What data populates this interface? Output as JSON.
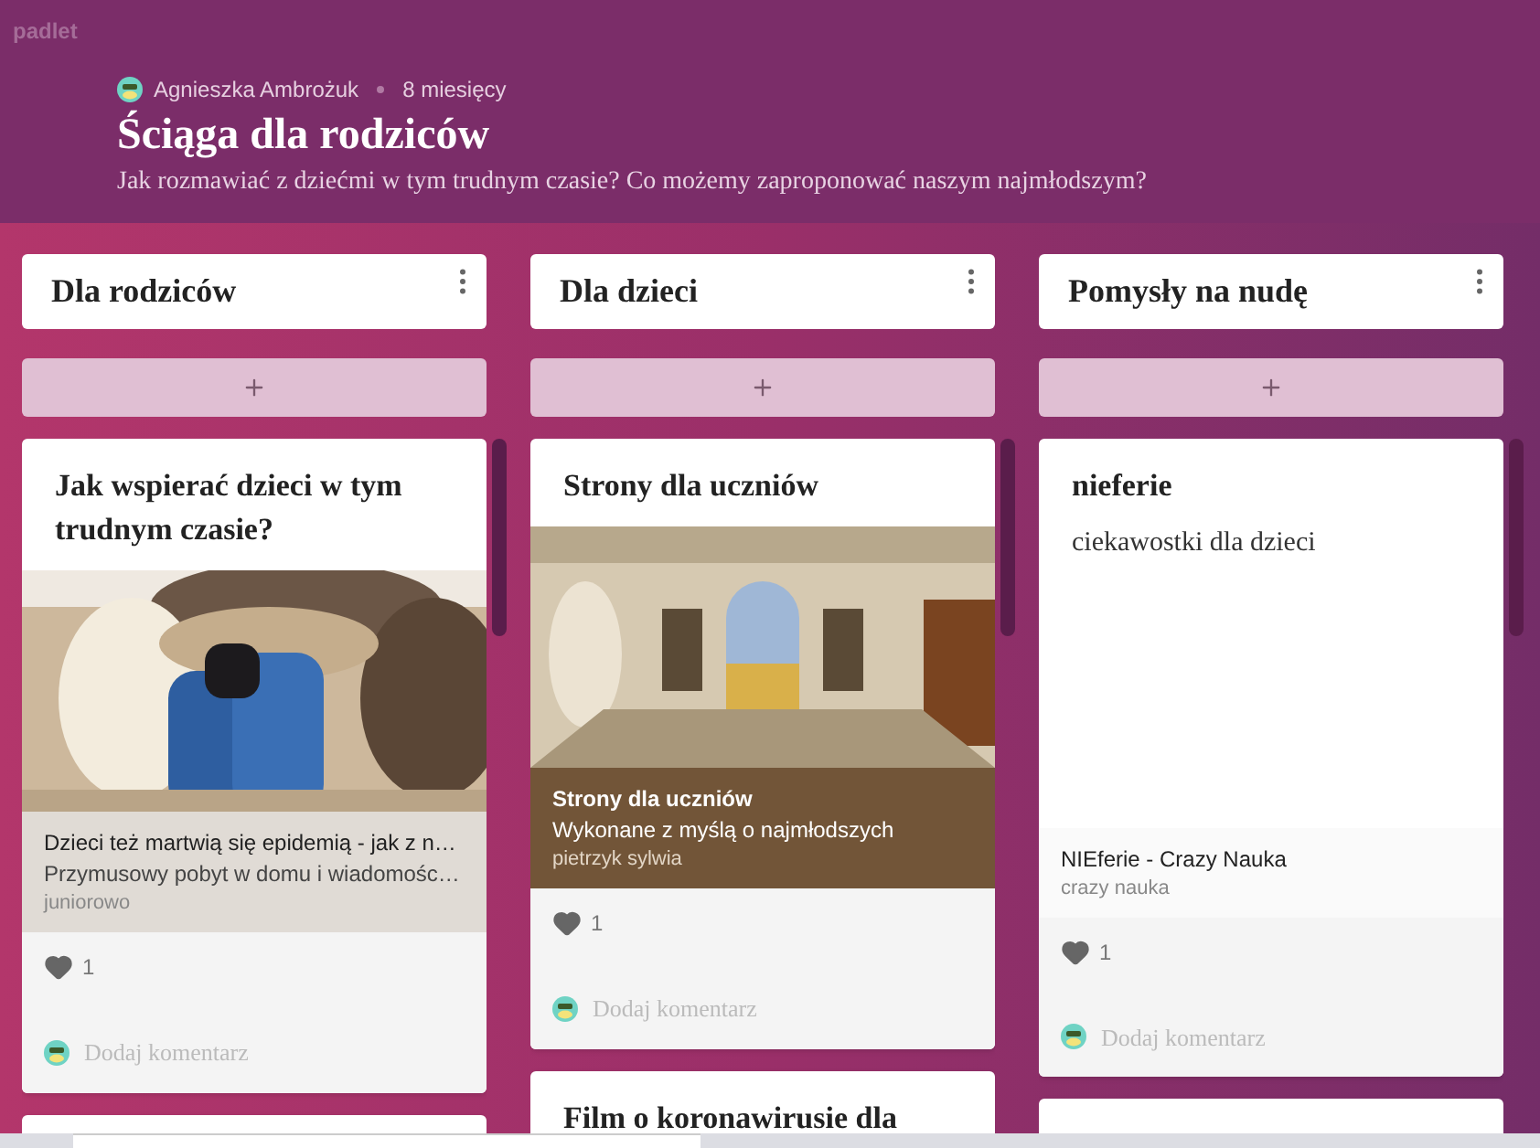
{
  "brand": "padlet",
  "header": {
    "author": "Agnieszka Ambrożuk",
    "time": "8 miesięcy",
    "title": "Ściąga dla rodziców",
    "description": "Jak rozmawiać z dziećmi w tym trudnym czasie? Co możemy zaproponować naszym najmłodszym?"
  },
  "columns": [
    {
      "title": "Dla rodziców",
      "posts": [
        {
          "kind": "full",
          "title": "Jak wspierać dzieci w tym trudnym czasie?",
          "attachment": {
            "kind": "picture",
            "dark": false,
            "title": "Dzieci też martwią się epidemią - jak z n…",
            "description": "Przymusowy pobyt w domu i wiadomośc…",
            "source": "juniorowo",
            "color": "#e0dbd5"
          },
          "likes": "1",
          "comment_placeholder": "Dodaj komentarz"
        },
        {
          "kind": "cut"
        }
      ]
    },
    {
      "title": "Dla dzieci",
      "posts": [
        {
          "kind": "full",
          "title": "Strony dla uczniów",
          "attachment": {
            "kind": "picture",
            "dark": true,
            "title": "Strony dla uczniów",
            "description": "Wykonane z myślą o najmłodszych",
            "source": "pietrzyk sylwia",
            "color": "#725538"
          },
          "likes": "1",
          "comment_placeholder": "Dodaj komentarz"
        },
        {
          "kind": "cut",
          "title": "Film o koronawirusie dla"
        }
      ]
    },
    {
      "title": "Pomysły na nudę",
      "posts": [
        {
          "kind": "full",
          "title": "nieferie",
          "body": "ciekawostki dla dzieci",
          "attachment": {
            "kind": "link",
            "dark": false,
            "title": "NIEferie - Crazy Nauka",
            "source": "crazy nauka",
            "color": "#fafafa"
          },
          "likes": "1",
          "comment_placeholder": "Dodaj komentarz"
        },
        {
          "kind": "cut"
        }
      ]
    }
  ]
}
